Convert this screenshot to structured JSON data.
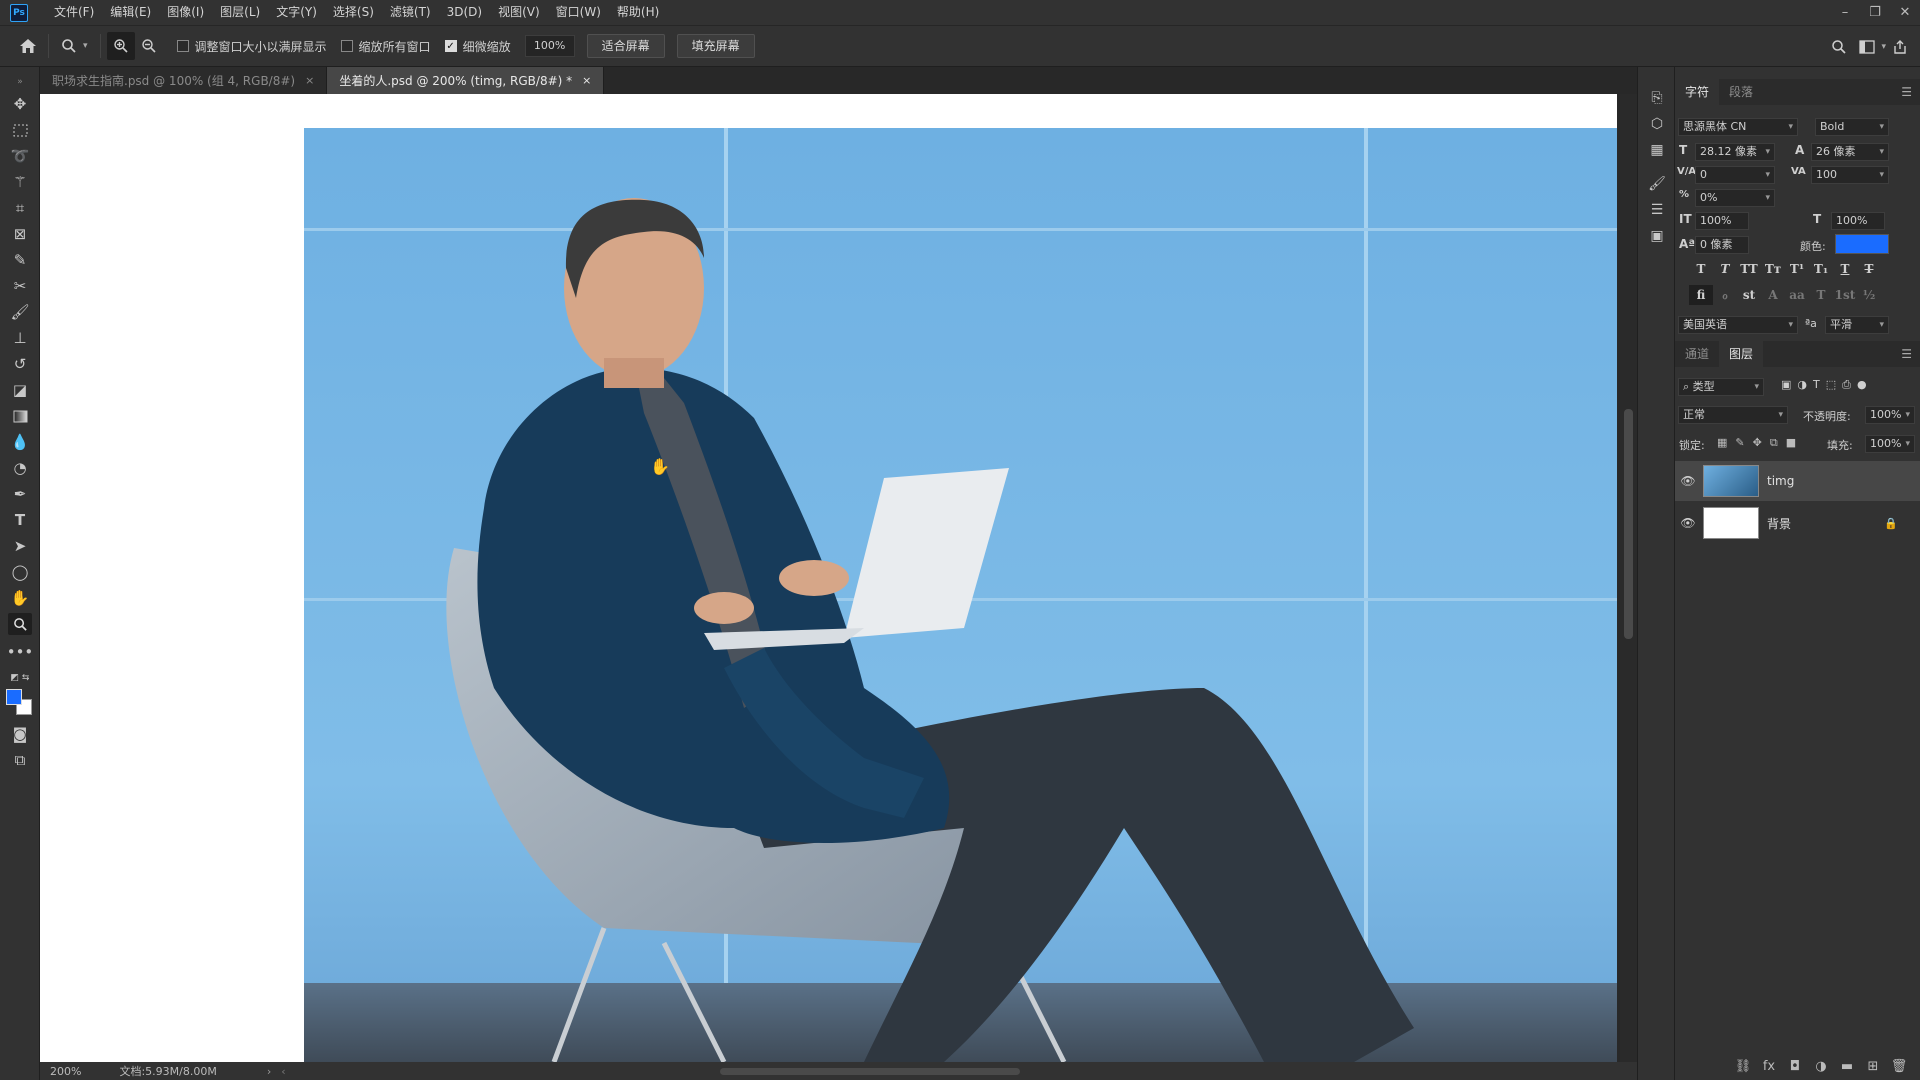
{
  "app": {
    "logo": "Ps",
    "menus": [
      "文件(F)",
      "编辑(E)",
      "图像(I)",
      "图层(L)",
      "文字(Y)",
      "选择(S)",
      "滤镜(T)",
      "3D(D)",
      "视图(V)",
      "窗口(W)",
      "帮助(H)"
    ]
  },
  "options": {
    "resize_windows": "调整窗口大小以满屏显示",
    "zoom_all": "缩放所有窗口",
    "scrubby_zoom": "细微缩放",
    "zoom_value": "100%",
    "fit_screen": "适合屏幕",
    "fill_screen": "填充屏幕"
  },
  "tabs": [
    {
      "label": "职场求生指南.psd @ 100% (组 4, RGB/8#)",
      "close": "×"
    },
    {
      "label": "坐着的人.psd @ 200% (timg, RGB/8#) *",
      "close": "×"
    }
  ],
  "status": {
    "zoom": "200%",
    "doc_size": "文档:5.93M/8.00M"
  },
  "character_panel": {
    "tabs": [
      "字符",
      "段落"
    ],
    "font_family": "思源黑体 CN",
    "font_style": "Bold",
    "font_size": "28.12 像素",
    "leading": "26 像素",
    "kerning": "0",
    "tracking": "100",
    "tsume": "0%",
    "vertical_scale": "100%",
    "horizontal_scale": "100%",
    "baseline_shift": "0 像素",
    "color_label": "颜色:",
    "color_value": "#1a6cff",
    "language": "美国英语",
    "antialias_icon": "ªa",
    "antialias": "平滑",
    "typo_buttons": [
      "T",
      "T",
      "TT",
      "Tт",
      "T¹",
      "T₁",
      "T",
      "T"
    ],
    "opentype_buttons": [
      "fi",
      "ℴ",
      "st",
      "A",
      "aa",
      "T",
      "1st",
      "½"
    ]
  },
  "layers_panel": {
    "tabs": [
      "通道",
      "图层"
    ],
    "filter": "类型",
    "blend_mode": "正常",
    "opacity_label": "不透明度:",
    "opacity": "100%",
    "lock_label": "锁定:",
    "fill_label": "填充:",
    "fill": "100%",
    "layers": [
      {
        "name": "timg",
        "selected": true
      },
      {
        "name": "背景",
        "selected": false,
        "locked": true
      }
    ]
  },
  "icons": {
    "lock": "🔒"
  }
}
